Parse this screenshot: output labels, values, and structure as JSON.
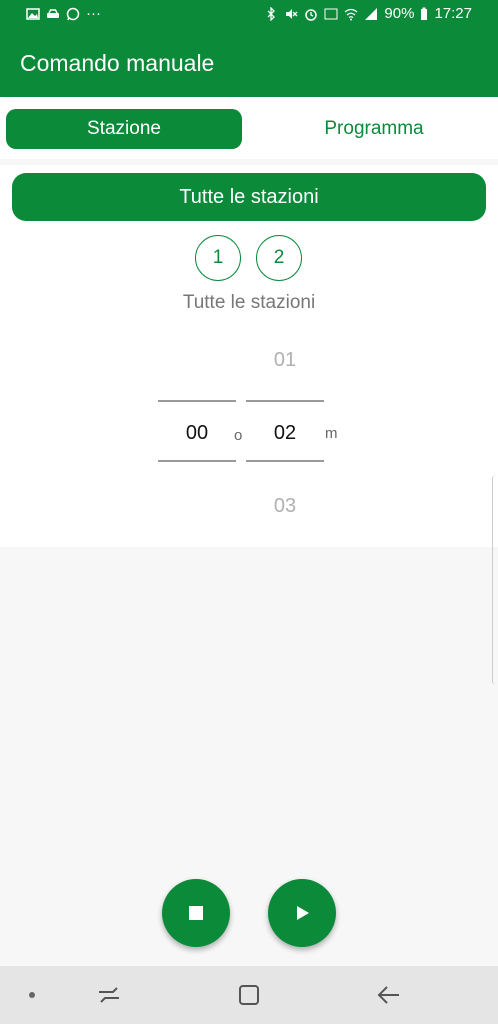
{
  "status_bar": {
    "battery": "90%",
    "time": "17:27",
    "more": "···",
    "icons_left": [
      "image-icon",
      "car-icon",
      "whatsapp-icon"
    ],
    "icons_right": [
      "bluetooth-icon",
      "mute-icon",
      "alarm-icon",
      "volte-icon",
      "wifi-icon",
      "signal-icon",
      "battery-icon"
    ]
  },
  "app_bar": {
    "title": "Comando manuale"
  },
  "tabs": [
    {
      "label": "Stazione",
      "active": true
    },
    {
      "label": "Programma",
      "active": false
    }
  ],
  "all_stations_button": "Tutte le stazioni",
  "stations": [
    "1",
    "2"
  ],
  "selected_label": "Tutte le stazioni",
  "time_picker": {
    "hours": {
      "current": "00",
      "unit": "o"
    },
    "minutes": {
      "previous": "01",
      "current": "02",
      "next": "03",
      "unit": "m"
    }
  },
  "actions": {
    "stop": "stop-icon",
    "play": "play-icon"
  },
  "nav": [
    "dot-icon",
    "recent-apps-icon",
    "home-icon",
    "back-icon"
  ],
  "colors": {
    "primary": "#0b8a3a",
    "background": "#f7f7f7"
  }
}
